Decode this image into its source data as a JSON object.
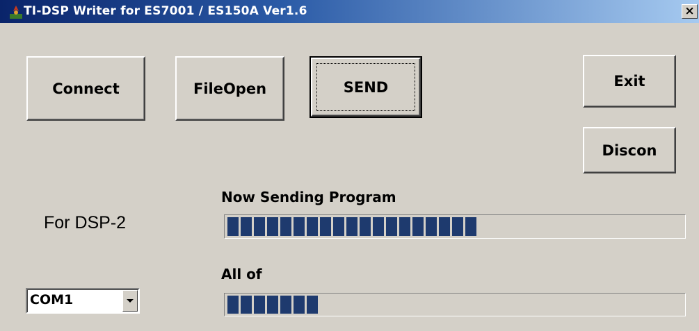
{
  "window": {
    "title": "TI-DSP Writer for ES7001 / ES150A Ver1.6",
    "close_symbol": "×",
    "icon": "app-icon"
  },
  "buttons": {
    "connect": "Connect",
    "file_open": "FileOpen",
    "send": "SEND",
    "exit": "Exit",
    "discon": "Discon"
  },
  "target_label": "For DSP-2",
  "progress": {
    "now_sending_label": "Now Sending Program",
    "now_sending_blocks": 19,
    "now_sending_fraction": 0.6,
    "all_of_label": "All of",
    "all_of_blocks": 7,
    "all_of_fraction": 0.22
  },
  "port": {
    "selected": "COM1"
  },
  "colors": {
    "progress_fill": "#1e3a6e",
    "title_gradient_start": "#0a246a",
    "title_gradient_end": "#a6caf0"
  }
}
